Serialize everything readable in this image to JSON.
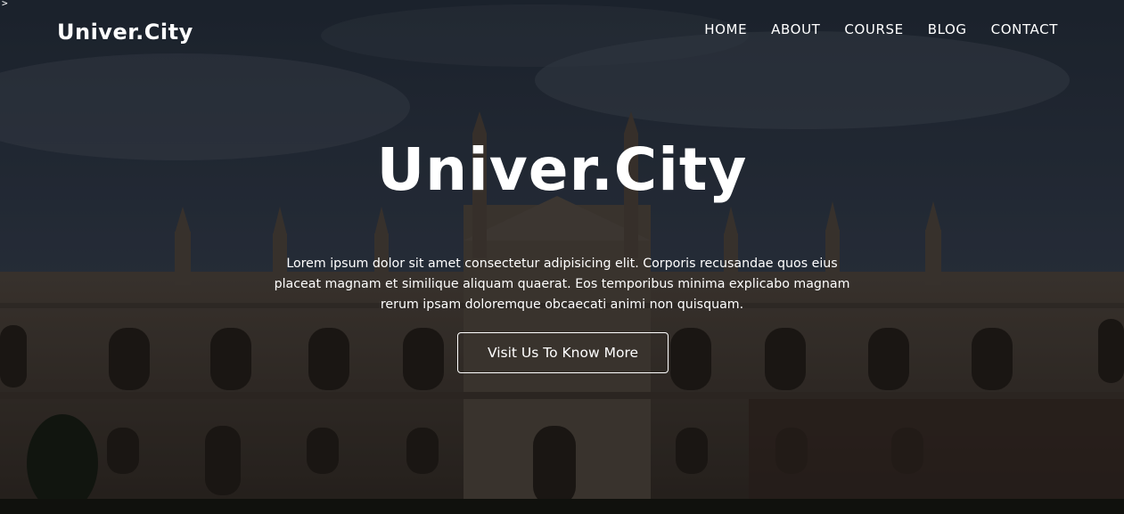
{
  "brand": {
    "logo": "Univer.City"
  },
  "nav": {
    "items": [
      "HOME",
      "ABOUT",
      "COURSE",
      "BLOG",
      "CONTACT"
    ]
  },
  "hero": {
    "title": "Univer.City",
    "description": "Lorem ipsum dolor sit amet consectetur adipisicing elit. Corporis recusandae quos eius placeat magnam et similique aliquam quaerat. Eos temporibus minima explicabo magnam rerum ipsam doloremque obcaecati animi non quisquam.",
    "cta_label": "Visit Us To Know More"
  },
  "corner_mark": ">",
  "colors": {
    "text": "#ffffff",
    "overlay": "rgba(0,0,0,0.38)"
  }
}
